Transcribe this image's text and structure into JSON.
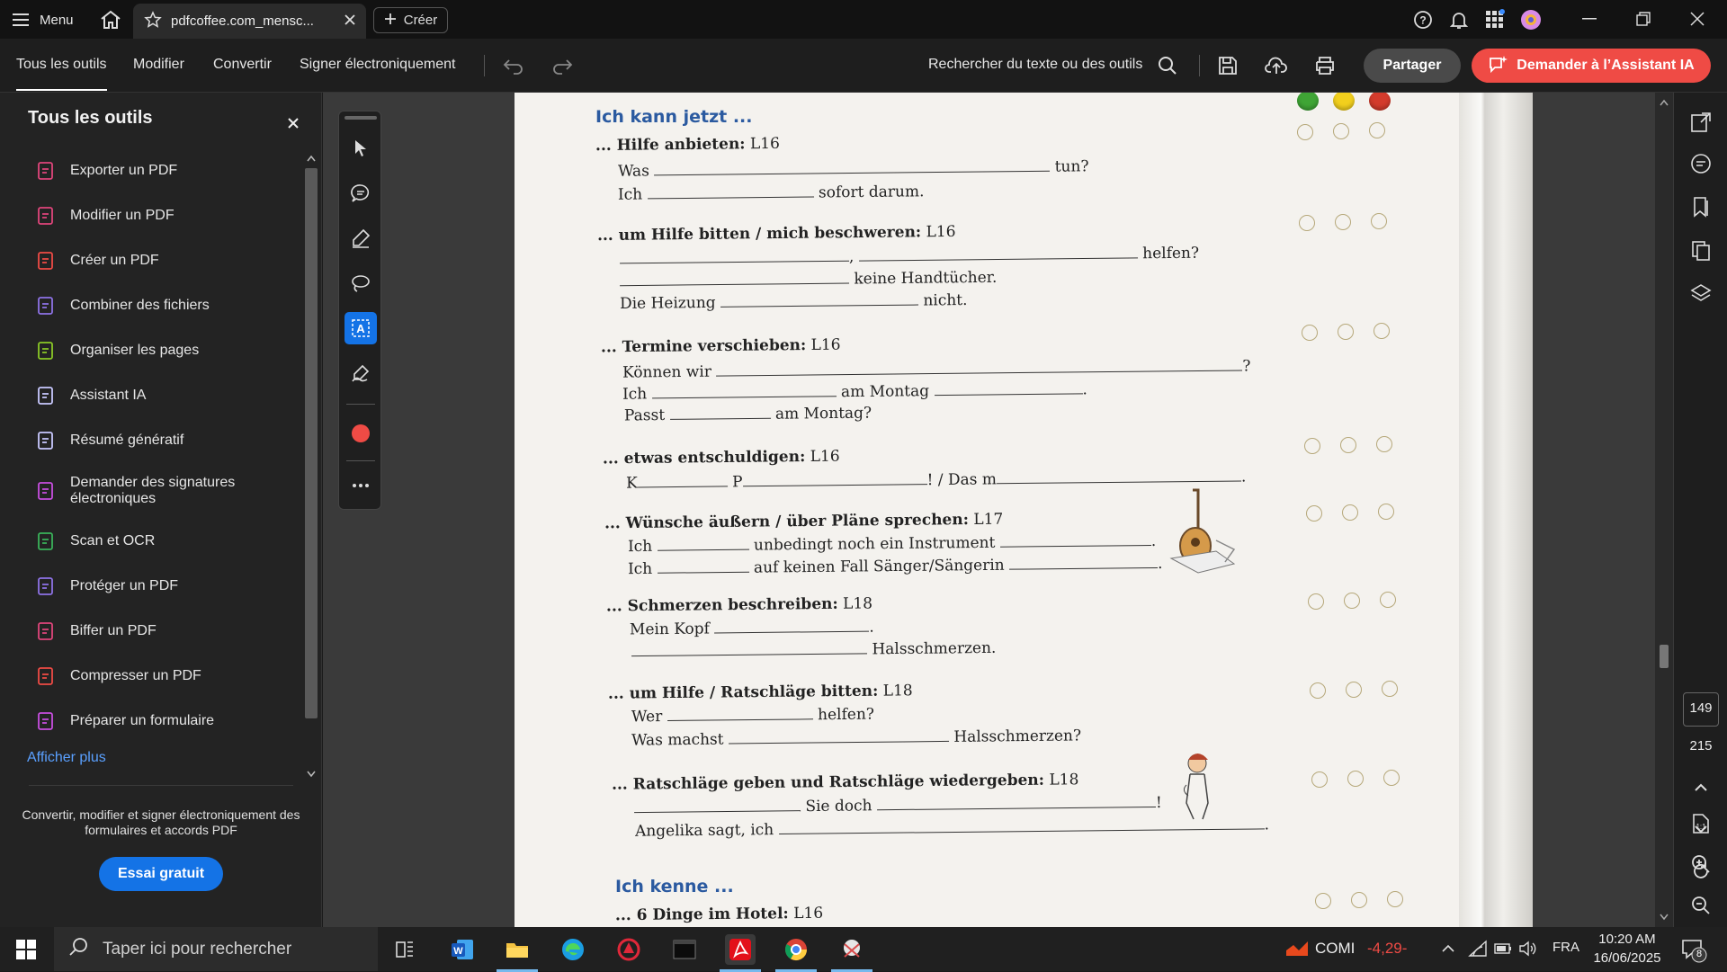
{
  "tabbar": {
    "menu_label": "Menu",
    "tab_title": "pdfcoffee.com_mensc...",
    "create_label": "Créer"
  },
  "toolbar": {
    "items": [
      "Tous les outils",
      "Modifier",
      "Convertir",
      "Signer électroniquement"
    ],
    "search_label": "Rechercher du texte ou des outils",
    "share_label": "Partager",
    "ai_label": "Demander à l’Assistant IA"
  },
  "left_panel": {
    "title": "Tous les outils",
    "items": [
      {
        "label": "Exporter un PDF",
        "icon": "export-pdf-icon",
        "color": "#e0457b"
      },
      {
        "label": "Modifier un PDF",
        "icon": "edit-pdf-icon",
        "color": "#e0457b"
      },
      {
        "label": "Créer un PDF",
        "icon": "create-pdf-icon",
        "color": "#ef4b45"
      },
      {
        "label": "Combiner des fichiers",
        "icon": "combine-files-icon",
        "color": "#8e72e6"
      },
      {
        "label": "Organiser les pages",
        "icon": "organize-pages-icon",
        "color": "#8ac926"
      },
      {
        "label": "Assistant IA",
        "icon": "ai-assistant-icon",
        "color": "#c9c9ff"
      },
      {
        "label": "Résumé génératif",
        "icon": "generative-summary-icon",
        "color": "#c9c9ff"
      },
      {
        "label": "Demander des signatures électroniques",
        "icon": "request-signatures-icon",
        "color": "#c84ee0"
      },
      {
        "label": "Scan et OCR",
        "icon": "scan-ocr-icon",
        "color": "#3ab35a"
      },
      {
        "label": "Protéger un PDF",
        "icon": "protect-pdf-icon",
        "color": "#8e72e6"
      },
      {
        "label": "Biffer un PDF",
        "icon": "redact-pdf-icon",
        "color": "#e0457b"
      },
      {
        "label": "Compresser un PDF",
        "icon": "compress-pdf-icon",
        "color": "#ef4b45"
      },
      {
        "label": "Préparer un formulaire",
        "icon": "prepare-form-icon",
        "color": "#c84ee0"
      }
    ],
    "show_more": "Afficher plus",
    "description": "Convertir, modifier et signer électroniquement des formulaires et accords PDF",
    "trial_button": "Essai gratuit"
  },
  "document": {
    "heading1": "Ich kann jetzt ...",
    "heading2": "Ich kenne ...",
    "s1_title": "... Hilfe anbieten:",
    "s1_ref": "L16",
    "s1_l1a": "Was",
    "s1_l1b": "tun?",
    "s1_l2a": "Ich",
    "s1_l2b": "sofort darum.",
    "s2_title": "... um Hilfe bitten / mich beschweren:",
    "s2_ref": "L16",
    "s2_l1b": "helfen?",
    "s2_l2b": "keine Handtücher.",
    "s2_l3a": "Die Heizung",
    "s2_l3b": "nicht.",
    "s3_title": "... Termine verschieben:",
    "s3_ref": "L16",
    "s3_l1a": "Können wir",
    "s3_l1b": "?",
    "s3_l2a": "Ich",
    "s3_l2b": "am Montag",
    "s3_l2c": ".",
    "s3_l3a": "Passt",
    "s3_l3b": "am Montag?",
    "s4_title": "... etwas entschuldigen:",
    "s4_ref": "L16",
    "s4_l1a": "K",
    "s4_l1b": "P",
    "s4_l1c": "! / Das m",
    "s4_l1d": ".",
    "s5_title": "... Wünsche äußern / über Pläne sprechen:",
    "s5_ref": "L17",
    "s5_l1a": "Ich",
    "s5_l1b": "unbedingt noch ein Instrument",
    "s5_l1c": ".",
    "s5_l2a": "Ich",
    "s5_l2b": "auf keinen Fall Sänger/Sängerin",
    "s5_l2c": ".",
    "s6_title": "... Schmerzen beschreiben:",
    "s6_ref": "L18",
    "s6_l1a": "Mein Kopf",
    "s6_l1b": ".",
    "s6_l2b": "Halsschmerzen.",
    "s7_title": "... um Hilfe / Ratschläge bitten:",
    "s7_ref": "L18",
    "s7_l1a": "Wer",
    "s7_l1b": "helfen?",
    "s7_l2a": "Was machst",
    "s7_l2b": "Halsschmerzen?",
    "s8_title": "... Ratschläge geben und Ratschläge wiedergeben:",
    "s8_ref": "L18",
    "s8_l1a": "Sie doch",
    "s8_l1b": "!",
    "s8_l2a": "Angelika sagt, ich",
    "s8_l2b": ".",
    "s9_title": "... 6 Dinge im Hotel:",
    "s9_ref": "L16",
    "dot_colors": [
      "#3fa535",
      "#f2cf1d",
      "#d33b2c"
    ]
  },
  "page_indicator": {
    "current": "149",
    "total": "215"
  },
  "taskbar": {
    "search_placeholder": "Taper ici pour rechercher",
    "stock_name": "COMI",
    "stock_change": "-4,29-",
    "language": "FRA",
    "time": "10:20 AM",
    "date": "16/06/2025",
    "notification_count": "8"
  }
}
